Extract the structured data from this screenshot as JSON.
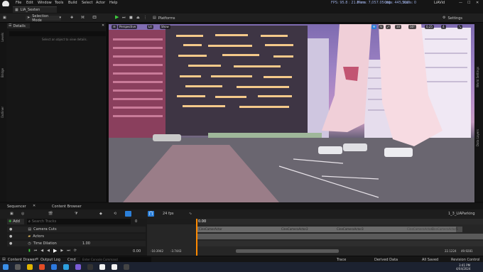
{
  "menubar": {
    "items": [
      "File",
      "Edit",
      "Window",
      "Tools",
      "Build",
      "Select",
      "Actor",
      "Help"
    ],
    "stats": {
      "fps": "FPS: 95.8 : 21.8 ms",
      "mem": "Mem: 7,057.05 mb",
      "objs": "Objs: 445,300",
      "stalls": "Stalls: 0"
    },
    "user": "LiAVid"
  },
  "tab": {
    "label": "LIA_Sexten"
  },
  "toolbar": {
    "mode": "Selection Mode",
    "platforms": "Platforms",
    "settings": "Settings"
  },
  "left_strip": {
    "items": [
      "Levels",
      "Bridge",
      "Outliner"
    ]
  },
  "details": {
    "title": "Details",
    "empty_text": "Select an object to view details."
  },
  "viewport": {
    "view_mode": "Perspective",
    "lit": "Lit",
    "show": "Show",
    "snap_value": "10",
    "angle_value": "10°",
    "scale_value": "0.25",
    "camera_speed": "4"
  },
  "right_strip": {
    "items": [
      "World Settings",
      "Data Layers"
    ]
  },
  "sequencer": {
    "tabs": [
      "Sequencer",
      "Content Browser"
    ],
    "fps": "24 fps",
    "breadcrumb": "1_3_LIAParking",
    "add_label": "Add",
    "search_placeholder": "Search Tracks",
    "frame_start": "0",
    "playhead": "0.00",
    "tracks": [
      {
        "name": "Camera Cuts"
      },
      {
        "name": "Actors"
      },
      {
        "name": "Time Dilation",
        "value": "1.00"
      }
    ],
    "clips": [
      "CineCamerActor",
      "CineCameraActor2",
      "CineCameraActor3",
      "CineCameraActor4",
      "CineCameraActor5"
    ],
    "bottom": {
      "frame_left": "0.00",
      "range_a": "-10.3942",
      "range_b": "-3.7443",
      "end_a": "22.1224",
      "end_b": "49.9281"
    }
  },
  "statusbar": {
    "content_drawer": "Content Drawer",
    "output_log": "Output Log",
    "cmd": "Cmd",
    "console_placeholder": "Enter Console Command",
    "trace": "Trace",
    "derived": "Derived Data",
    "saved": "All Saved",
    "revision": "Revision Control"
  },
  "taskbar": {
    "time": "3:41 PM",
    "date": "4/04/2024"
  },
  "colors": {
    "accent": "#2b7fd9",
    "play": "#3dcc3d",
    "clip": "#6a6a6a",
    "playhead": "#ff8a00"
  }
}
